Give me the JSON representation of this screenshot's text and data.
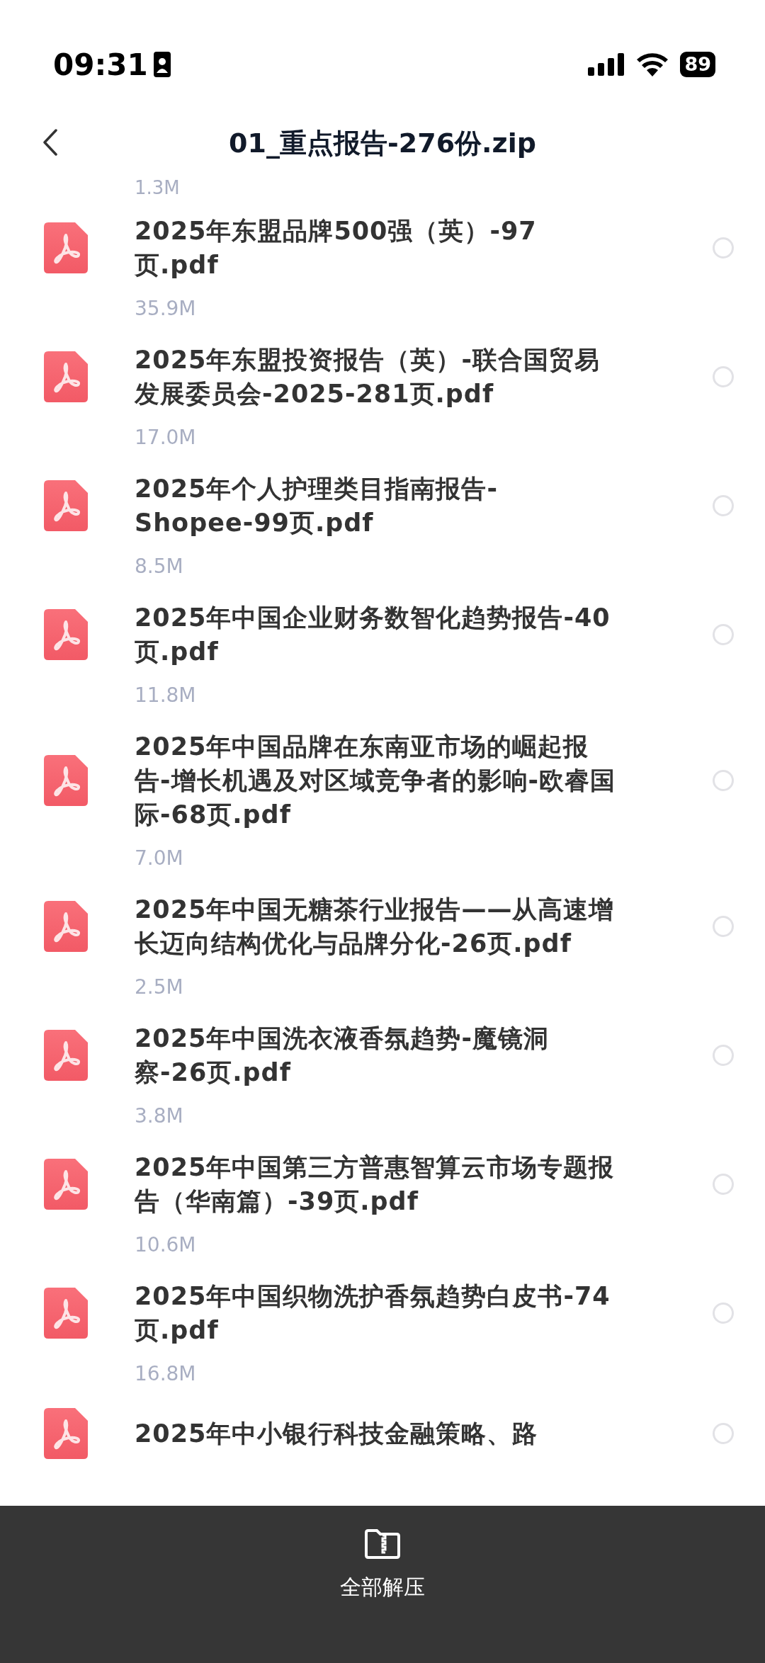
{
  "status_bar": {
    "time": "09:31",
    "battery": "89"
  },
  "header": {
    "title": "01_重点报告-276份.zip"
  },
  "top_partial_size": "1.3M",
  "files": [
    {
      "name": "2025年东盟品牌500强（英）-97页.pdf",
      "size": "35.9M",
      "selected": false
    },
    {
      "name": "2025年东盟投资报告（英）-联合国贸易发展委员会-2025-281页.pdf",
      "size": "17.0M",
      "selected": false
    },
    {
      "name": "2025年个人护理类目指南报告-Shopee-99页.pdf",
      "size": "8.5M",
      "selected": false
    },
    {
      "name": "2025年中国企业财务数智化趋势报告-40页.pdf",
      "size": "11.8M",
      "selected": false
    },
    {
      "name": "2025年中国品牌在东南亚市场的崛起报告-增长机遇及对区域竞争者的影响-欧睿国际-68页.pdf",
      "size": "7.0M",
      "selected": false
    },
    {
      "name": "2025年中国无糖茶行业报告——从高速增长迈向结构优化与品牌分化-26页.pdf",
      "size": "2.5M",
      "selected": false
    },
    {
      "name": "2025年中国洗衣液香氛趋势-魔镜洞察-26页.pdf",
      "size": "3.8M",
      "selected": false
    },
    {
      "name": "2025年中国第三方普惠智算云市场专题报告（华南篇）-39页.pdf",
      "size": "10.6M",
      "selected": false
    },
    {
      "name": "2025年中国织物洗护香氛趋势白皮书-74页.pdf",
      "size": "16.8M",
      "selected": false
    },
    {
      "name": "2025年中小银行科技金融策略、路",
      "selected": false
    }
  ],
  "bottom_bar": {
    "label": "全部解压"
  }
}
